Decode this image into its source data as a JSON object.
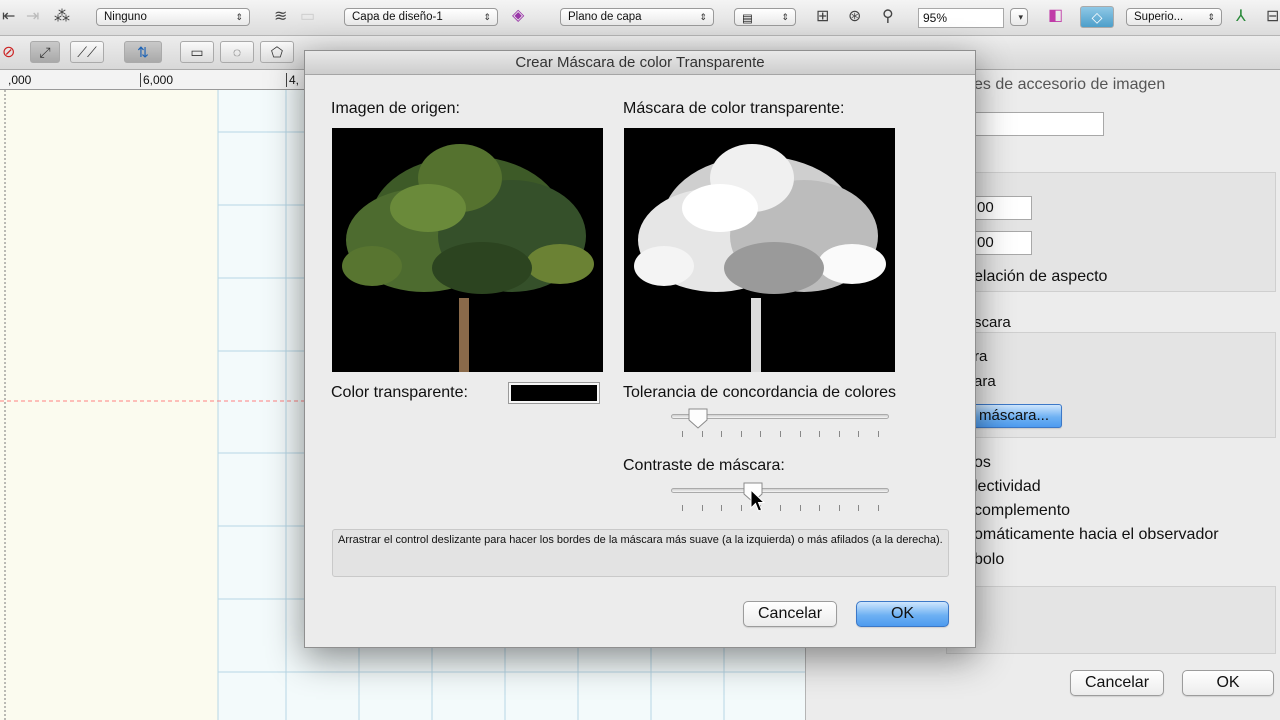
{
  "toolbar": {
    "class_popup": "Ninguno",
    "layer_popup": "Capa de diseño-1",
    "plane_popup": "Plano de capa",
    "zoom_value": "95%",
    "view_popup": "Superio..."
  },
  "ruler": {
    "ticks": [
      ",000",
      "6,000",
      "4,"
    ]
  },
  "side_panel": {
    "title": "es de accesorio de imagen",
    "field_w": "00",
    "field_h": "00",
    "aspect_label": "elación de aspecto",
    "mask_header": "scara",
    "opt1": "ra",
    "opt2": "ara",
    "mask_button": "máscara...",
    "row1": "os",
    "row2": "lectividad",
    "row3": "complemento",
    "row4": "omáticamente hacia el observador",
    "row5": "bolo",
    "cancel": "Cancelar",
    "ok": "OK"
  },
  "dialog": {
    "title": "Crear Máscara de color Transparente",
    "source_label": "Imagen de origen:",
    "mask_label": "Máscara de color transparente:",
    "transparent_color_label": "Color transparente:",
    "transparent_color": "#000000",
    "tolerance_label": "Tolerancia de concordancia de colores",
    "tolerance_value": 0.08,
    "contrast_label": "Contraste de máscara:",
    "contrast_value": 0.36,
    "hint": "Arrastrar el control deslizante para hacer los bordes de la máscara más suave (a la izquierda) o más afilados (a la derecha).",
    "cancel": "Cancelar",
    "ok": "OK"
  },
  "colors": {
    "default_button": "#5aa3f0",
    "canvas": "#fbfbef",
    "grid": "#b7d7e6",
    "guide": "#ff8080"
  }
}
